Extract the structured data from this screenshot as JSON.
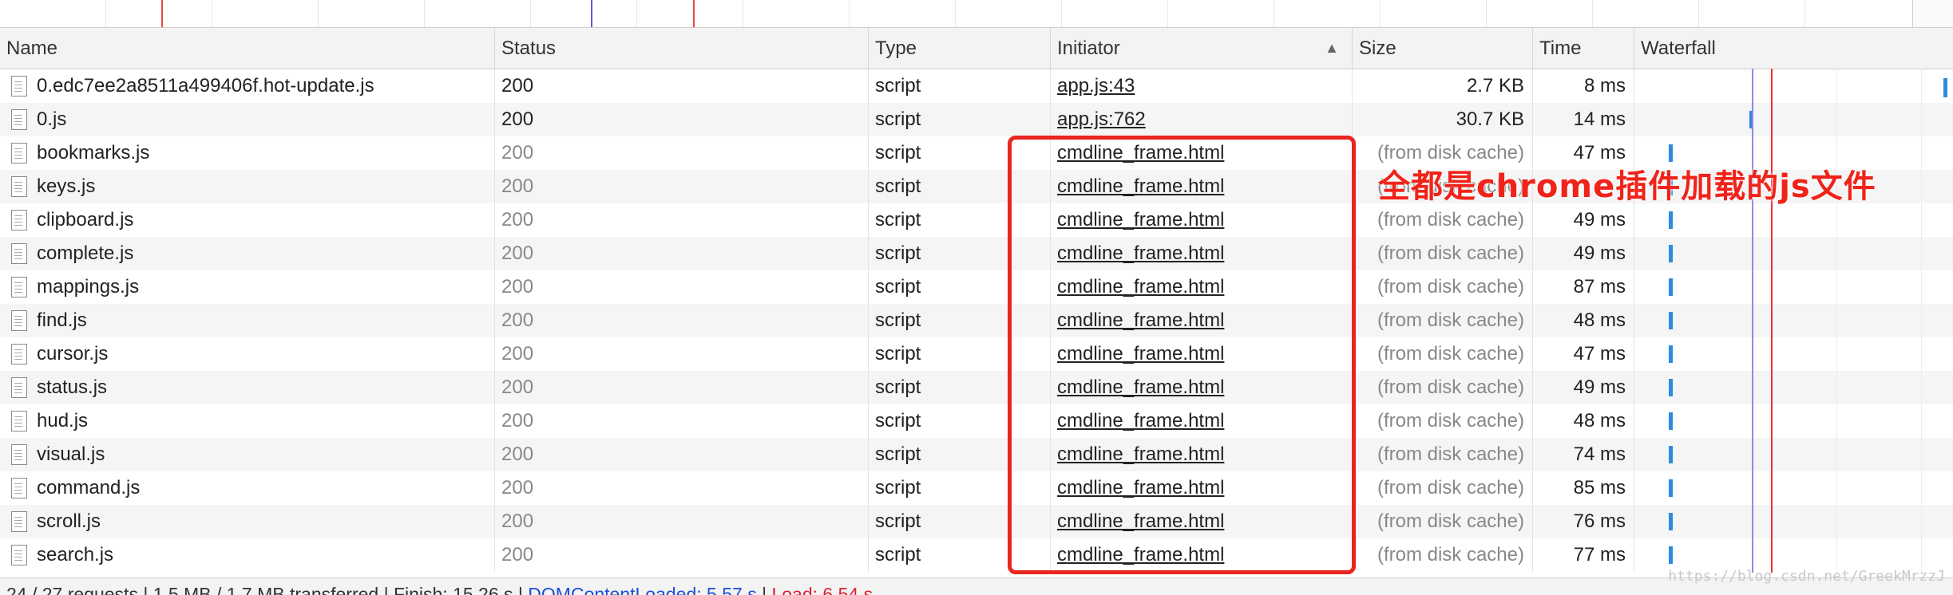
{
  "columns": [
    "Name",
    "Status",
    "Type",
    "Initiator",
    "Size",
    "Time",
    "Waterfall"
  ],
  "sort_indicator": "▲",
  "rows": [
    {
      "name": "0.edc7ee2a8511a499406f.hot-update.js",
      "status": "200",
      "type": "script",
      "initiator": "app.js:43",
      "size": "2.7 KB",
      "time": "8 ms",
      "cached": false
    },
    {
      "name": "0.js",
      "status": "200",
      "type": "script",
      "initiator": "app.js:762",
      "size": "30.7 KB",
      "time": "14 ms",
      "cached": false
    },
    {
      "name": "bookmarks.js",
      "status": "200",
      "type": "script",
      "initiator": "cmdline_frame.html",
      "size": "(from disk cache)",
      "time": "47 ms",
      "cached": true
    },
    {
      "name": "keys.js",
      "status": "200",
      "type": "script",
      "initiator": "cmdline_frame.html",
      "size": "(from disk cache)",
      "time": "",
      "cached": true
    },
    {
      "name": "clipboard.js",
      "status": "200",
      "type": "script",
      "initiator": "cmdline_frame.html",
      "size": "(from disk cache)",
      "time": "49 ms",
      "cached": true
    },
    {
      "name": "complete.js",
      "status": "200",
      "type": "script",
      "initiator": "cmdline_frame.html",
      "size": "(from disk cache)",
      "time": "49 ms",
      "cached": true
    },
    {
      "name": "mappings.js",
      "status": "200",
      "type": "script",
      "initiator": "cmdline_frame.html",
      "size": "(from disk cache)",
      "time": "87 ms",
      "cached": true
    },
    {
      "name": "find.js",
      "status": "200",
      "type": "script",
      "initiator": "cmdline_frame.html",
      "size": "(from disk cache)",
      "time": "48 ms",
      "cached": true
    },
    {
      "name": "cursor.js",
      "status": "200",
      "type": "script",
      "initiator": "cmdline_frame.html",
      "size": "(from disk cache)",
      "time": "47 ms",
      "cached": true
    },
    {
      "name": "status.js",
      "status": "200",
      "type": "script",
      "initiator": "cmdline_frame.html",
      "size": "(from disk cache)",
      "time": "49 ms",
      "cached": true
    },
    {
      "name": "hud.js",
      "status": "200",
      "type": "script",
      "initiator": "cmdline_frame.html",
      "size": "(from disk cache)",
      "time": "48 ms",
      "cached": true
    },
    {
      "name": "visual.js",
      "status": "200",
      "type": "script",
      "initiator": "cmdline_frame.html",
      "size": "(from disk cache)",
      "time": "74 ms",
      "cached": true
    },
    {
      "name": "command.js",
      "status": "200",
      "type": "script",
      "initiator": "cmdline_frame.html",
      "size": "(from disk cache)",
      "time": "85 ms",
      "cached": true
    },
    {
      "name": "scroll.js",
      "status": "200",
      "type": "script",
      "initiator": "cmdline_frame.html",
      "size": "(from disk cache)",
      "time": "76 ms",
      "cached": true
    },
    {
      "name": "search.js",
      "status": "200",
      "type": "script",
      "initiator": "cmdline_frame.html",
      "size": "(from disk cache)",
      "time": "77 ms",
      "cached": true
    }
  ],
  "annotation": "全都是chrome插件加载的js文件",
  "footer": {
    "summary": "24 / 27 requests | 1.5 MB / 1.7 MB transferred | Finish: 15.26 s | ",
    "dom_loaded": "DOMContentLoaded: 5.57 s",
    "sep": " | ",
    "load": "Load: 6.54 s"
  },
  "watermark": "https://blog.csdn.net/GreekMrzzJ",
  "colors": {
    "accent_blue": "#2b8be0",
    "annotation_red": "#e8261d",
    "dom_line": "#8a8af0",
    "load_line": "#e33"
  }
}
